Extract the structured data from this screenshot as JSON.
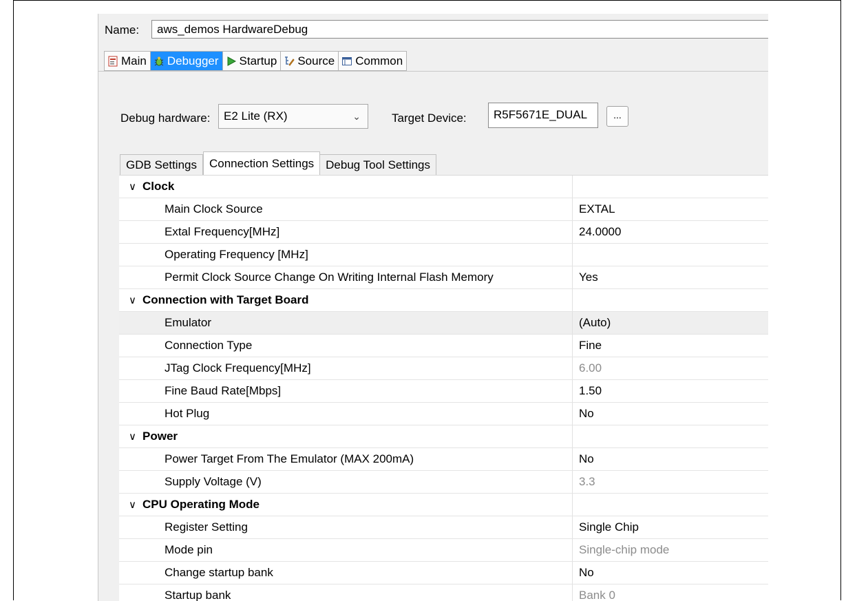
{
  "name": {
    "label": "Name:",
    "value": "aws_demos HardwareDebug"
  },
  "tabs": [
    {
      "label": "Main",
      "icon": "main-tab-icon",
      "active": false
    },
    {
      "label": "Debugger",
      "icon": "debugger-bug-icon",
      "active": true
    },
    {
      "label": "Startup",
      "icon": "startup-play-icon",
      "active": false
    },
    {
      "label": "Source",
      "icon": "source-lookup-icon",
      "active": false
    },
    {
      "label": "Common",
      "icon": "common-table-icon",
      "active": false
    }
  ],
  "debugger": {
    "hardware_label": "Debug hardware:",
    "hardware_value": "E2 Lite (RX)",
    "target_label": "Target Device:",
    "target_value": "R5F5671E_DUAL",
    "browse_label": "..."
  },
  "subtabs": [
    "GDB Settings",
    "Connection Settings",
    "Debug Tool Settings"
  ],
  "grid": [
    {
      "type": "cat",
      "label": "Clock"
    },
    {
      "type": "item",
      "label": "Main Clock Source",
      "value": "EXTAL"
    },
    {
      "type": "item",
      "label": "Extal Frequency[MHz]",
      "value": "24.0000"
    },
    {
      "type": "item",
      "label": "Operating Frequency [MHz]",
      "value": ""
    },
    {
      "type": "item",
      "label": "Permit Clock Source Change On Writing Internal Flash Memory",
      "value": "Yes"
    },
    {
      "type": "cat",
      "label": "Connection with Target Board"
    },
    {
      "type": "item",
      "label": "Emulator",
      "value": "(Auto)",
      "highlight": true
    },
    {
      "type": "item",
      "label": "Connection Type",
      "value": "Fine"
    },
    {
      "type": "item",
      "label": "JTag Clock Frequency[MHz]",
      "value": "6.00",
      "disabled": true
    },
    {
      "type": "item",
      "label": "Fine Baud Rate[Mbps]",
      "value": "1.50"
    },
    {
      "type": "item",
      "label": "Hot Plug",
      "value": "No"
    },
    {
      "type": "cat",
      "label": "Power"
    },
    {
      "type": "item",
      "label": "Power Target From The Emulator (MAX 200mA)",
      "value": "No"
    },
    {
      "type": "item",
      "label": "Supply Voltage (V)",
      "value": "3.3",
      "disabled": true
    },
    {
      "type": "cat",
      "label": "CPU Operating Mode"
    },
    {
      "type": "item",
      "label": "Register Setting",
      "value": "Single Chip"
    },
    {
      "type": "item",
      "label": "Mode pin",
      "value": "Single-chip mode",
      "disabled": true
    },
    {
      "type": "item",
      "label": "Change startup bank",
      "value": "No"
    },
    {
      "type": "item",
      "label": "Startup bank",
      "value": "Bank 0",
      "disabled": true
    }
  ]
}
